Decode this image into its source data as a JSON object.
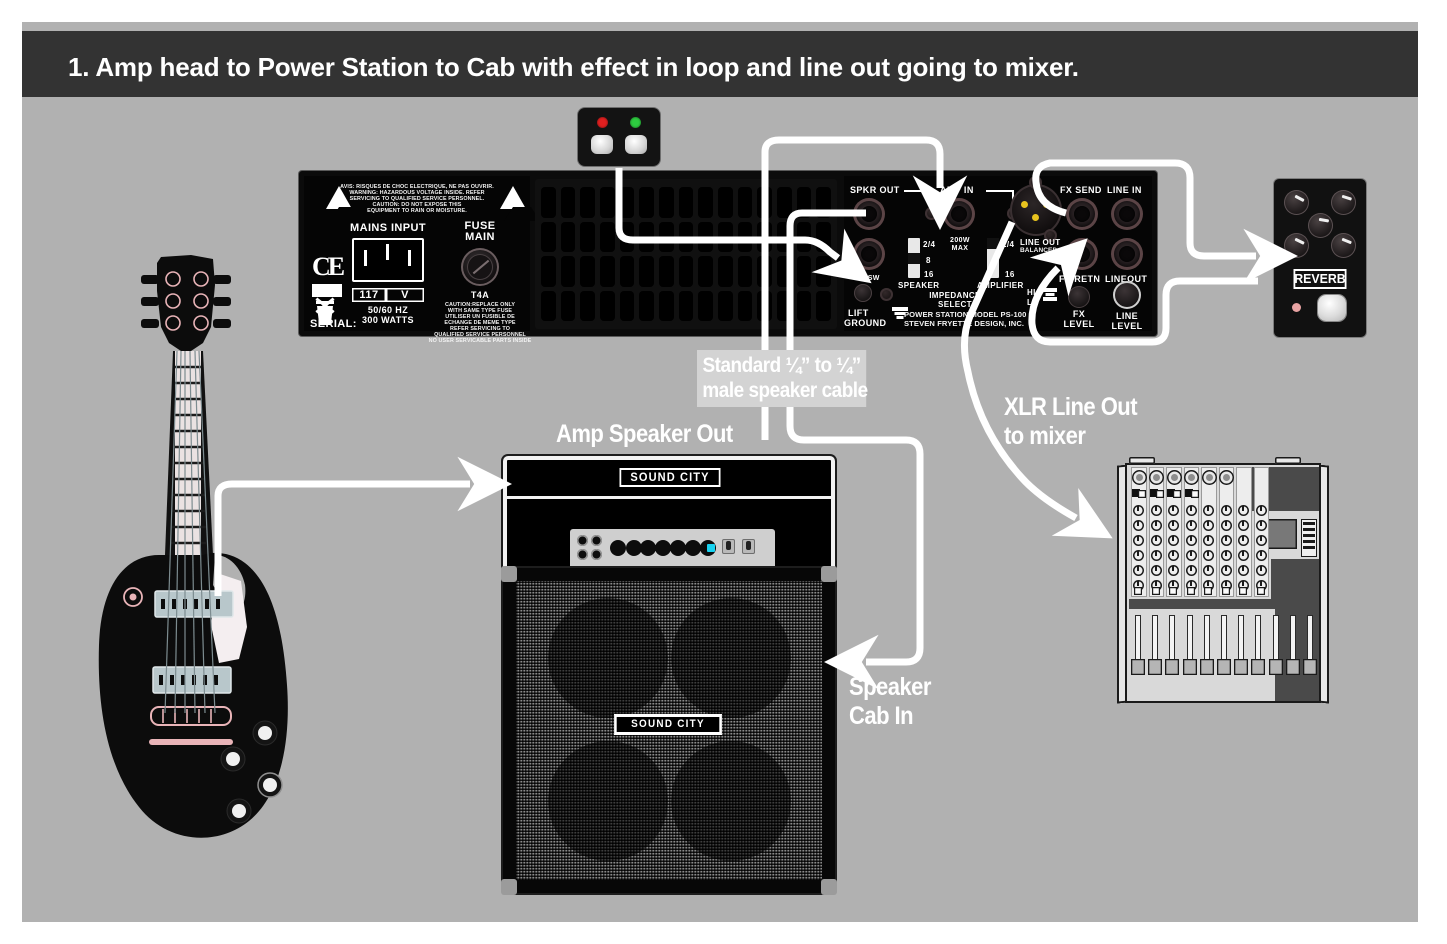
{
  "title": "1. Amp head to Power Station to Cab with effect in loop and line out going to mixer.",
  "theme": {
    "background": "#b1b1b1",
    "title_bar": "#333333",
    "title_text": "#ffffff",
    "cable": "#ffffff",
    "device_black": "#0a0a0a",
    "led_red": "#e02020",
    "led_green": "#2ecc40",
    "led_cyan": "#19d2f0",
    "led_pink": "#e8a3a3",
    "xlr_pin": "#e8c31e"
  },
  "callouts": [
    {
      "id": "cable_type",
      "lines": [
        "Standard ¼” to ¼”",
        "male speaker cable"
      ],
      "style": "boxed"
    },
    {
      "id": "amp_speaker_out",
      "lines": [
        "Amp Speaker Out"
      ],
      "style": "plain"
    },
    {
      "id": "xlr_line_out",
      "lines": [
        "XLR Line Out",
        "to mixer"
      ],
      "style": "plain"
    },
    {
      "id": "speaker_cab_in",
      "lines": [
        "Speaker",
        "Cab In"
      ],
      "style": "plain"
    }
  ],
  "power_station": {
    "model_line_1": "POWER STATION MODEL PS-100",
    "model_line_2": "STEVEN FRYETTE DESIGN, INC.",
    "warning_lines": [
      "AVIS: RISQUES DE CHOC ELECTRIQUE, NE PAS OUVRIR.",
      "WARNING: HAZARDOUS VOLTAGE INSIDE. REFER",
      "SERVICING TO QUALIFIED SERVICE PERSONNEL.",
      "CAUTION: DO NOT EXPOSE THIS",
      "EQUIPMENT TO RAIN OR MOISTURE."
    ],
    "mains_input_label": "MAINS INPUT",
    "voltage": "117",
    "voltage_unit": "V",
    "frequency": "50/60 HZ",
    "wattage": "300 WATTS",
    "serial_label": "SERIAL:",
    "ce_mark": "CE",
    "fuse_label_1": "FUSE",
    "fuse_label_2": "MAIN",
    "fuse_rating": "T4A",
    "fuse_note_lines": [
      "CAUTION:REPLACE ONLY",
      "WITH SAME TYPE FUSE",
      "UTILISER UN FUSIBLE DE",
      "ECHANGE DE MEME TYPE",
      "REFER SERVICING TO",
      "QUALIFIED SERVICE PERSONNEL",
      "NO USER SERVICABLE PARTS INSIDE"
    ],
    "jacks": {
      "spkr_out": "SPKR OUT",
      "amp_in": "AMP IN",
      "amp_in_rating": "200W\nMAX",
      "ft_sw": "FT SW",
      "fx_send": "FX SEND",
      "line_in": "LINE IN",
      "fx_retn": "FX RETN",
      "line_out_jack": "LINEOUT",
      "line_out_xlr_1": "LINE OUT",
      "line_out_xlr_2": "BALANCED"
    },
    "impedance": {
      "title_1": "IMPEDANCE",
      "title_2": "SELECT",
      "speaker_label": "SPEAKER",
      "amplifier_label": "AMPLIFIER",
      "options": [
        "2/4",
        "8",
        "16"
      ]
    },
    "controls": {
      "lift_1": "LIFT",
      "lift_2": "GROUND",
      "hi": "HI",
      "lo": "LO",
      "fx_level_1": "FX",
      "fx_level_2": "LEVEL",
      "line_level_1": "LINE",
      "line_level_2": "LEVEL"
    }
  },
  "amp_head": {
    "brand": "SOUND CITY",
    "knob_count": 7,
    "input_jack_count": 4,
    "toggle_count": 2
  },
  "speaker_cab": {
    "brand": "SOUND CITY",
    "speaker_count": 4
  },
  "pedal": {
    "name": "REVERB",
    "knob_count": 5
  },
  "footswitch": {
    "led_left": "red",
    "led_right": "green",
    "button_count": 2
  },
  "mixer": {
    "channel_count": 8,
    "fader_count": 11
  },
  "guitar": {
    "type": "electric-guitar",
    "pickup_count": 2,
    "knob_count": 4
  }
}
